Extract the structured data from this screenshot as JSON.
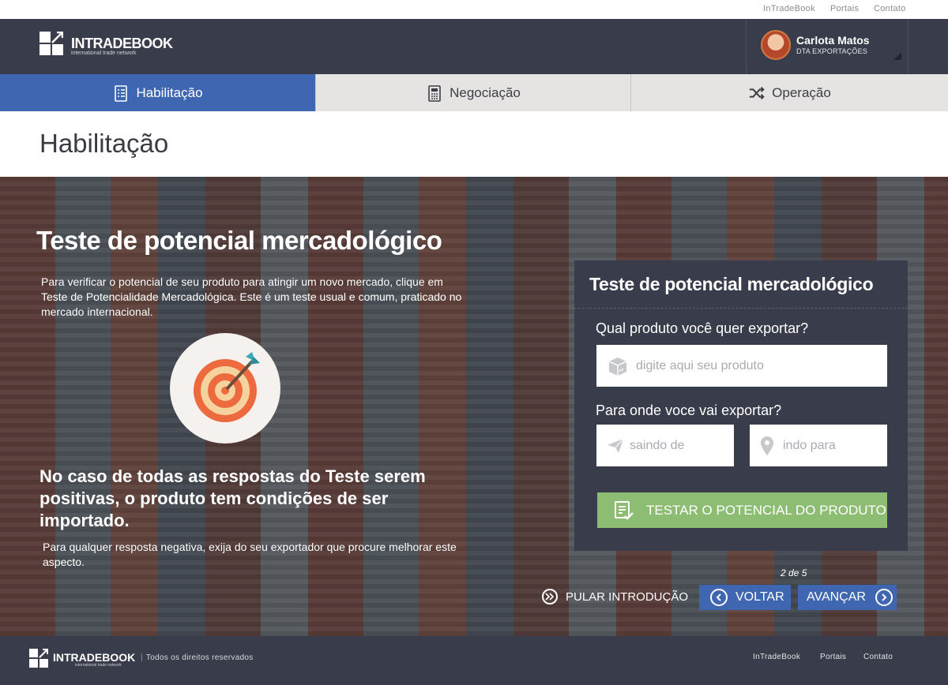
{
  "util_nav": {
    "items": [
      "InTradeBook",
      "Portais",
      "Contato"
    ]
  },
  "brand": {
    "name": "INTRADEBOOK",
    "tagline": "international trade network"
  },
  "user": {
    "name": "Carlota Matos",
    "role": "DTA EXPORTAÇÕES"
  },
  "tabs": [
    {
      "label": "Habilitação",
      "icon": "checklist-icon",
      "active": true
    },
    {
      "label": "Negociação",
      "icon": "calculator-icon",
      "active": false
    },
    {
      "label": "Operação",
      "icon": "shuffle-icon",
      "active": false
    }
  ],
  "page": {
    "title": "Habilitação"
  },
  "hero": {
    "title": "Teste de potencial mercadológico",
    "intro": "Para verificar o potencial de seu produto para atingir um novo mercado, clique em Teste de Potencialidade Mercadológica. Este é um teste usual e comum, praticado no mercado internacional.",
    "headline": "No caso de todas as respostas do Teste serem positivas, o produto tem condições de ser importado.",
    "note": "Para qualquer resposta negativa, exija do seu exportador que procure melhorar este aspecto."
  },
  "form": {
    "title": "Teste de potencial mercadológico",
    "product_label": "Qual produto você quer exportar?",
    "product_placeholder": "digite aqui seu produto",
    "destination_label": "Para onde voce vai exportar?",
    "from_placeholder": "saindo de",
    "to_placeholder": "indo para",
    "submit_label": "TESTAR O POTENCIAL DO PRODUTO"
  },
  "pager": {
    "text": "2 de 5"
  },
  "nav": {
    "skip_label": "PULAR INTRODUÇÃO",
    "back_label": "VOLTAR",
    "next_label": "AVANÇAR"
  },
  "footer": {
    "brand": "INTRADEBOOK",
    "tagline": "international trade network",
    "copyright": "Todos os direitos reservados",
    "links": [
      "InTradeBook",
      "Portais",
      "Contato"
    ]
  },
  "colors": {
    "header_bg": "#393c4a",
    "accent_blue": "#3f66b0",
    "submit_green": "#8dbd72",
    "tab_bg": "#e6e4e2"
  }
}
